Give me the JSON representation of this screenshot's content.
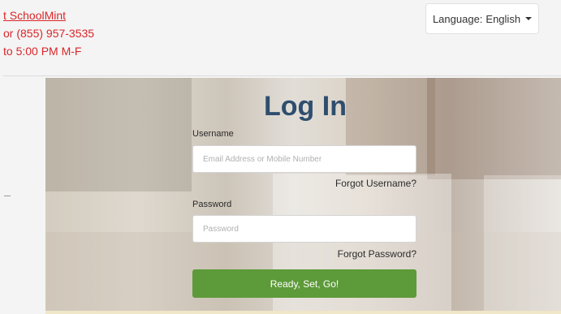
{
  "header": {
    "contact_link": "t SchoolMint",
    "phone": "or (855) 957-3535",
    "hours": "to 5:00 PM M-F",
    "language_label": "Language:",
    "language_value": "English"
  },
  "login": {
    "title": "Log In",
    "username_label": "Username",
    "username_placeholder": "Email Address or Mobile Number",
    "forgot_username": "Forgot Username?",
    "password_label": "Password",
    "password_placeholder": "Password",
    "forgot_password": "Forgot Password?",
    "submit_label": "Ready, Set, Go!"
  },
  "colors": {
    "accent_red": "#d9262a",
    "title_blue": "#2f4e6e",
    "button_green": "#5d9a39"
  },
  "icons": {
    "language_dropdown": "caret-down"
  }
}
